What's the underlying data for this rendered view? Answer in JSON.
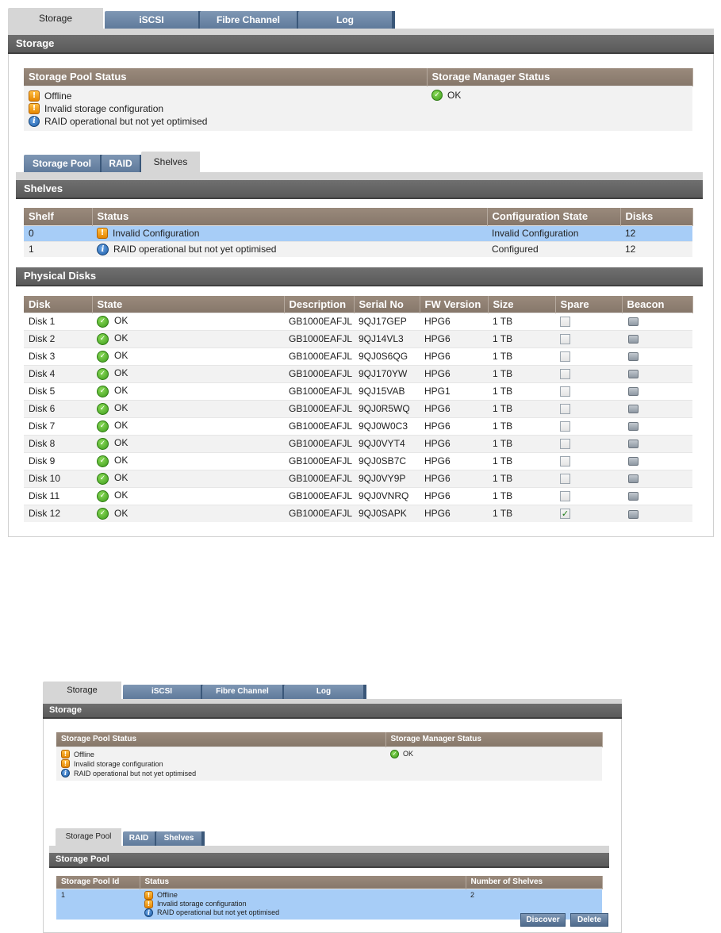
{
  "top": {
    "tabs": [
      "Storage",
      "iSCSI",
      "Fibre Channel",
      "Log"
    ],
    "title": "Storage",
    "pool_status_header": "Storage Pool Status",
    "manager_status_header": "Storage Manager Status",
    "pool_status_lines": [
      {
        "icon": "warning-icon",
        "text": "Offline"
      },
      {
        "icon": "warning-icon",
        "text": "Invalid storage configuration"
      },
      {
        "icon": "info-icon",
        "text": "RAID operational but not yet optimised"
      }
    ],
    "manager_status": {
      "icon": "ok-icon",
      "text": "OK"
    },
    "subtabs": [
      "Storage Pool",
      "RAID",
      "Shelves"
    ],
    "active_subtab": "Shelves",
    "shelves_title": "Shelves",
    "shelves_columns": [
      "Shelf",
      "Status",
      "Configuration State",
      "Disks"
    ],
    "shelves": [
      {
        "shelf": "0",
        "icon": "warning-icon",
        "status": "Invalid Configuration",
        "config": "Invalid Configuration",
        "disks": "12"
      },
      {
        "shelf": "1",
        "icon": "info-icon",
        "status": "RAID operational but not yet optimised",
        "config": "Configured",
        "disks": "12"
      }
    ],
    "disks_title": "Physical Disks",
    "disks_columns": [
      "Disk",
      "State",
      "Description",
      "Serial No",
      "FW Version",
      "Size",
      "Spare",
      "Beacon"
    ],
    "disks": [
      {
        "disk": "Disk 1",
        "state": "OK",
        "desc": "GB1000EAFJL",
        "serial": "9QJ17GEP",
        "fw": "HPG6",
        "size": "1 TB",
        "spare": false
      },
      {
        "disk": "Disk 2",
        "state": "OK",
        "desc": "GB1000EAFJL",
        "serial": "9QJ14VL3",
        "fw": "HPG6",
        "size": "1 TB",
        "spare": false
      },
      {
        "disk": "Disk 3",
        "state": "OK",
        "desc": "GB1000EAFJL",
        "serial": "9QJ0S6QG",
        "fw": "HPG6",
        "size": "1 TB",
        "spare": false
      },
      {
        "disk": "Disk 4",
        "state": "OK",
        "desc": "GB1000EAFJL",
        "serial": "9QJ170YW",
        "fw": "HPG6",
        "size": "1 TB",
        "spare": false
      },
      {
        "disk": "Disk 5",
        "state": "OK",
        "desc": "GB1000EAFJL",
        "serial": "9QJ15VAB",
        "fw": "HPG1",
        "size": "1 TB",
        "spare": false
      },
      {
        "disk": "Disk 6",
        "state": "OK",
        "desc": "GB1000EAFJL",
        "serial": "9QJ0R5WQ",
        "fw": "HPG6",
        "size": "1 TB",
        "spare": false
      },
      {
        "disk": "Disk 7",
        "state": "OK",
        "desc": "GB1000EAFJL",
        "serial": "9QJ0W0C3",
        "fw": "HPG6",
        "size": "1 TB",
        "spare": false
      },
      {
        "disk": "Disk 8",
        "state": "OK",
        "desc": "GB1000EAFJL",
        "serial": "9QJ0VYT4",
        "fw": "HPG6",
        "size": "1 TB",
        "spare": false
      },
      {
        "disk": "Disk 9",
        "state": "OK",
        "desc": "GB1000EAFJL",
        "serial": "9QJ0SB7C",
        "fw": "HPG6",
        "size": "1 TB",
        "spare": false
      },
      {
        "disk": "Disk 10",
        "state": "OK",
        "desc": "GB1000EAFJL",
        "serial": "9QJ0VY9P",
        "fw": "HPG6",
        "size": "1 TB",
        "spare": false
      },
      {
        "disk": "Disk 11",
        "state": "OK",
        "desc": "GB1000EAFJL",
        "serial": "9QJ0VNRQ",
        "fw": "HPG6",
        "size": "1 TB",
        "spare": false
      },
      {
        "disk": "Disk 12",
        "state": "OK",
        "desc": "GB1000EAFJL",
        "serial": "9QJ0SAPK",
        "fw": "HPG6",
        "size": "1 TB",
        "spare": true
      }
    ]
  },
  "bottom": {
    "tabs": [
      "Storage",
      "iSCSI",
      "Fibre Channel",
      "Log"
    ],
    "title": "Storage",
    "pool_status_header": "Storage Pool Status",
    "manager_status_header": "Storage Manager Status",
    "pool_status_lines": [
      {
        "icon": "warning-icon",
        "text": "Offline"
      },
      {
        "icon": "warning-icon",
        "text": "Invalid storage configuration"
      },
      {
        "icon": "info-icon",
        "text": "RAID operational but not yet optimised"
      }
    ],
    "manager_status": {
      "icon": "ok-icon",
      "text": "OK"
    },
    "subtabs": [
      "Storage Pool",
      "RAID",
      "Shelves"
    ],
    "active_subtab": "Storage Pool",
    "pool_title": "Storage Pool",
    "pool_columns": [
      "Storage Pool Id",
      "Status",
      "Number of Shelves"
    ],
    "pool_row": {
      "id": "1",
      "status_lines": [
        {
          "icon": "warning-icon",
          "text": "Offline"
        },
        {
          "icon": "warning-icon",
          "text": "Invalid storage configuration"
        },
        {
          "icon": "info-icon",
          "text": "RAID operational but not yet optimised"
        }
      ],
      "shelves": "2"
    },
    "buttons": {
      "discover": "Discover",
      "delete": "Delete"
    }
  }
}
